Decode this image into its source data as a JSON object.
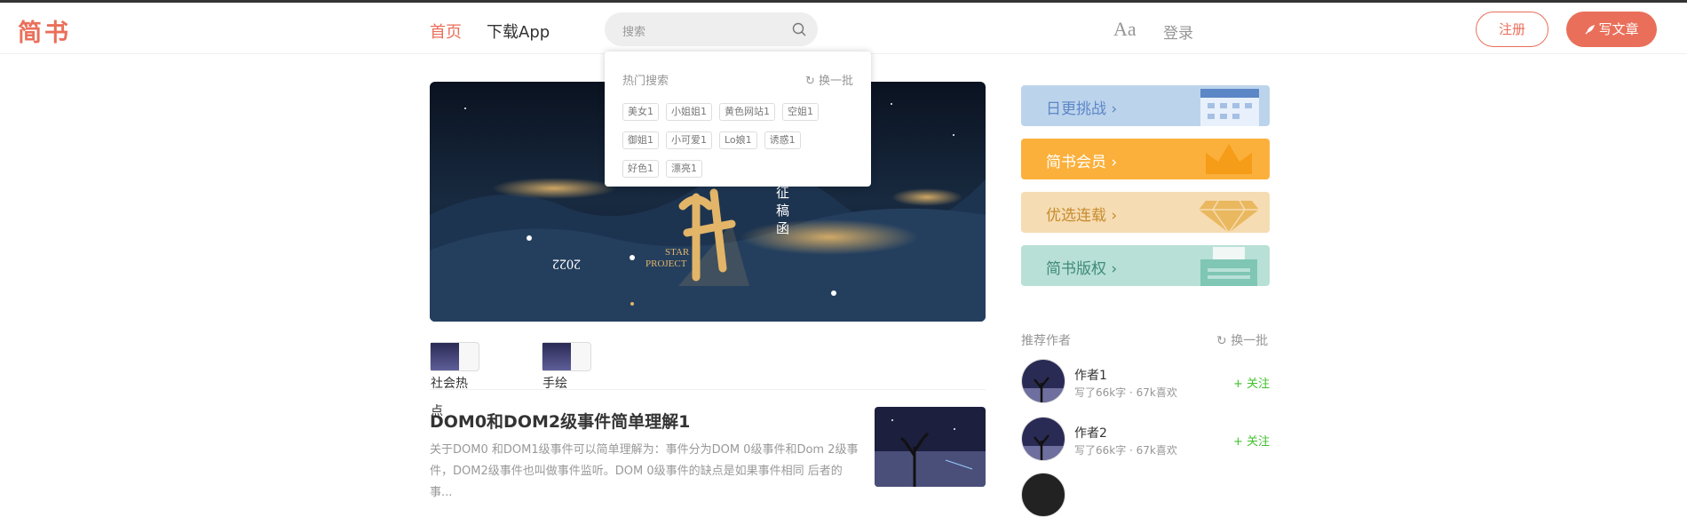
{
  "header": {
    "logo": "简书",
    "nav_home": "首页",
    "nav_app": "下载App",
    "search_placeholder": "搜索",
    "login": "登录",
    "signup": "注册",
    "write": "写文章"
  },
  "hot_search": {
    "title": "热门搜索",
    "refresh": "换一批",
    "tags": [
      "美女1",
      "小姐姐1",
      "黄色网站1",
      "空姐1",
      "御姐1",
      "小可爱1",
      "Lo娘1",
      "诱惑1",
      "好色1",
      "漂亮1"
    ]
  },
  "banner": {
    "year": "2022",
    "star": "STAR",
    "project": "PROJECT",
    "zheng": "征",
    "gao": "稿",
    "han": "函"
  },
  "topics": [
    {
      "label": "社会热点"
    },
    {
      "label": "手绘"
    }
  ],
  "article": {
    "title": "DOM0和DOM2级事件简单理解1",
    "abstract": "关于DOM0 和DOM1级事件可以简单理解为：事件分为DOM 0级事件和Dom 2级事件，DOM2级事件也叫做事件监听。DOM 0级事件的缺点是如果事件相同 后者的事..."
  },
  "boards": [
    {
      "label": "日更挑战 ›",
      "color": "#bcd3ec",
      "text_color": "#5c87c6"
    },
    {
      "label": "简书会员 ›",
      "color": "#fbb03b",
      "text_color": "#ffffff"
    },
    {
      "label": "优选连载 ›",
      "color": "#f6dcb2",
      "text_color": "#c68b2f"
    },
    {
      "label": "简书版权 ›",
      "color": "#b8e0d6",
      "text_color": "#3f8a7a"
    }
  ],
  "recommend": {
    "title": "推荐作者",
    "refresh": "换一批",
    "authors": [
      {
        "name": "作者1",
        "meta": "写了66k字 · 67k喜欢",
        "follow": "+ 关注"
      },
      {
        "name": "作者2",
        "meta": "写了66k字 · 67k喜欢",
        "follow": "+ 关注"
      }
    ]
  }
}
